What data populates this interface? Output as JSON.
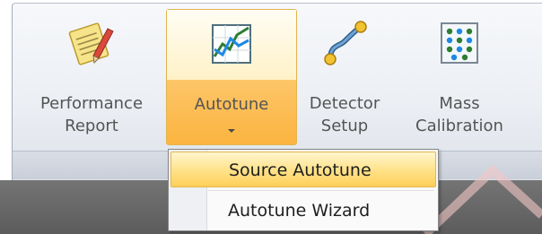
{
  "ribbon": {
    "buttons": [
      {
        "name": "performance-report",
        "line1": "Performance",
        "line2": "Report",
        "icon": "notepad-pencil-icon"
      },
      {
        "name": "autotune",
        "line1": "Autotune",
        "line2": "",
        "icon": "line-chart-icon",
        "active": true
      },
      {
        "name": "detector-setup",
        "line1": "Detector",
        "line2": "Setup",
        "icon": "curve-connector-icon"
      },
      {
        "name": "mass-calibration",
        "line1": "Mass",
        "line2": "Calibration",
        "icon": "dot-grid-icon"
      }
    ]
  },
  "dropdown": {
    "items": [
      {
        "label": "Source Autotune",
        "highlighted": true
      },
      {
        "label": "Autotune Wizard",
        "highlighted": false
      }
    ]
  },
  "colors": {
    "active_top": "#fff2c8",
    "active_bottom": "#fbb43f",
    "menu_highlight": "#ffd05a",
    "ribbon_bg": "#eceff4"
  }
}
